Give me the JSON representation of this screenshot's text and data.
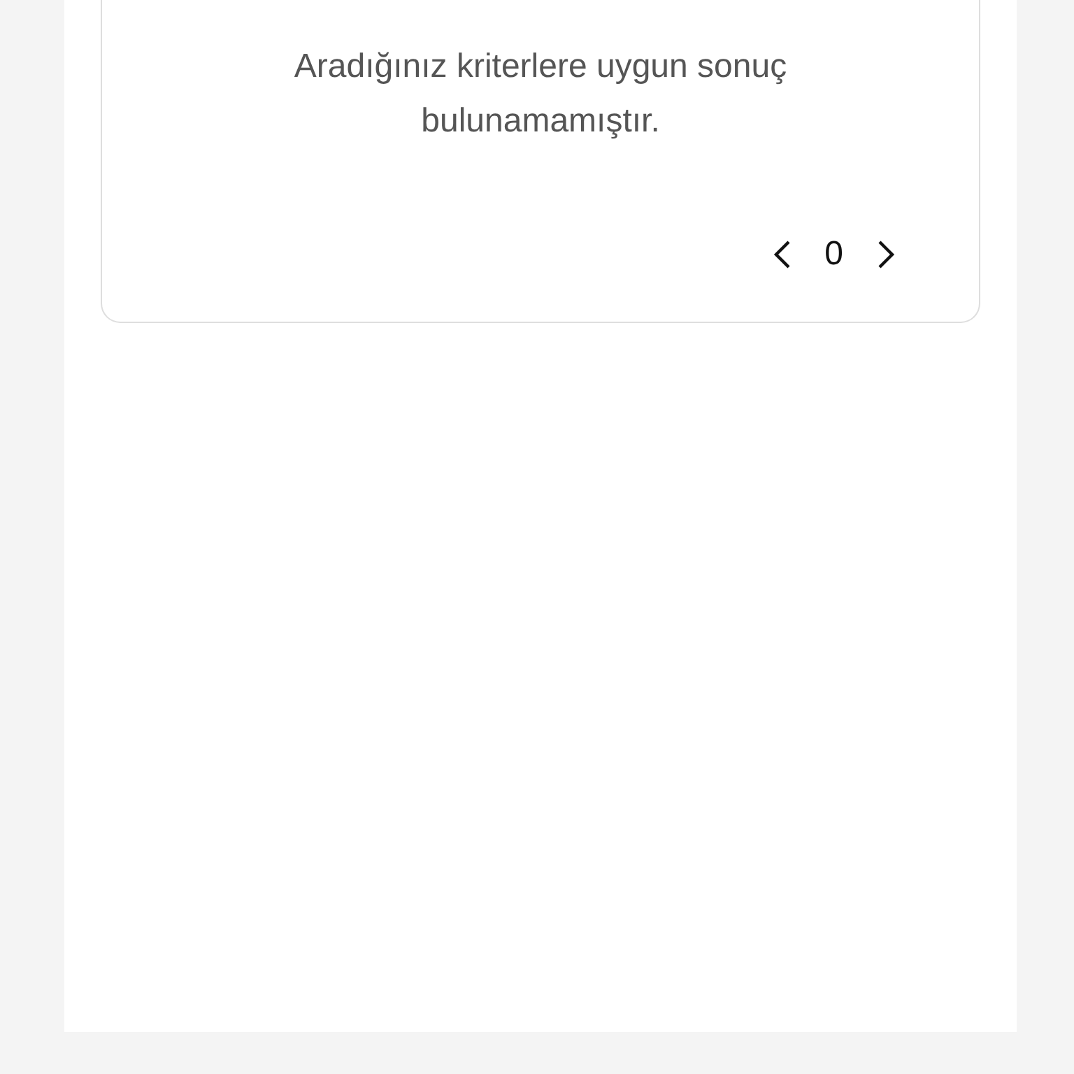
{
  "message": "Aradığınız kriterlere uygun sonuç bulunamamıştır.",
  "pagination": {
    "page": "0"
  }
}
